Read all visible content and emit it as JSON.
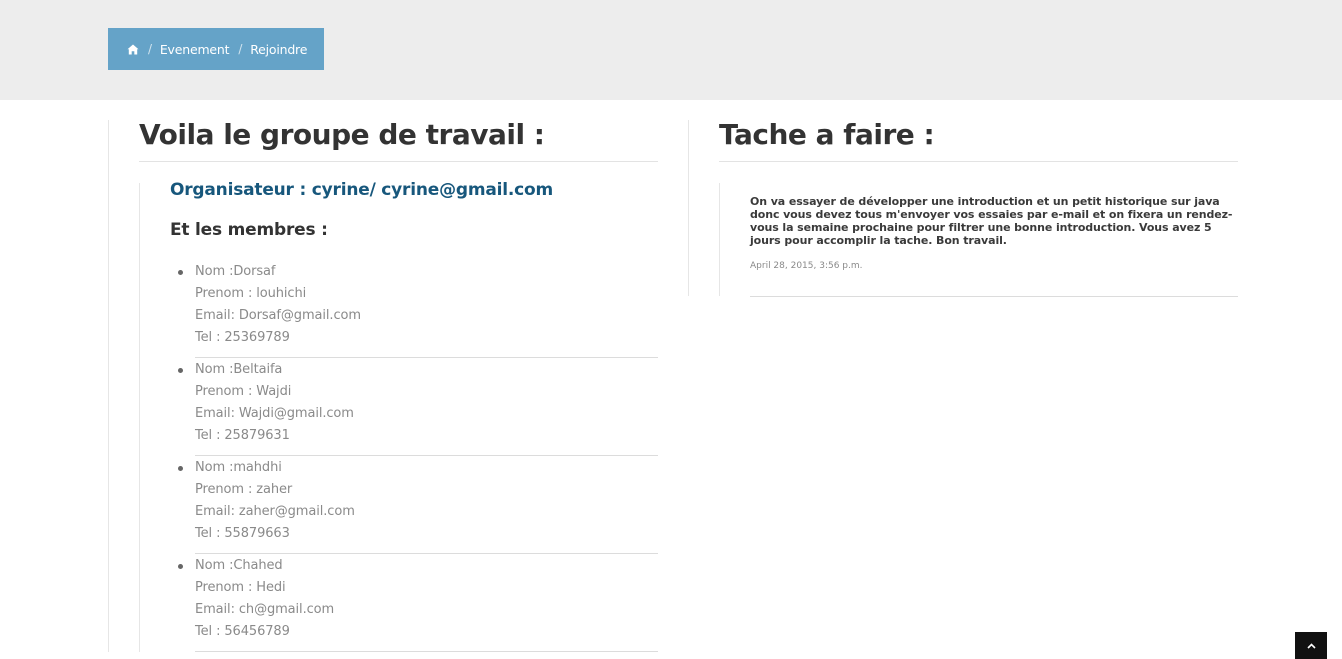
{
  "breadcrumb": {
    "home_icon": "home-icon",
    "separator": "/",
    "items": [
      "Evenement",
      "Rejoindre"
    ]
  },
  "left": {
    "title": "Voila le groupe de travail :",
    "organiser": "Organisateur : cyrine/ cyrine@gmail.com",
    "members_heading": "Et les membres :",
    "members": [
      {
        "nom": "Nom :Dorsaf",
        "prenom": "Prenom : louhichi",
        "email": "Email: Dorsaf@gmail.com",
        "tel": "Tel : 25369789"
      },
      {
        "nom": "Nom :Beltaifa",
        "prenom": "Prenom : Wajdi",
        "email": "Email: Wajdi@gmail.com",
        "tel": "Tel : 25879631"
      },
      {
        "nom": "Nom :mahdhi",
        "prenom": "Prenom : zaher",
        "email": "Email: zaher@gmail.com",
        "tel": "Tel : 55879663"
      },
      {
        "nom": "Nom :Chahed",
        "prenom": "Prenom : Hedi",
        "email": "Email: ch@gmail.com",
        "tel": "Tel : 56456789"
      }
    ]
  },
  "right": {
    "title": "Tache a faire :",
    "task_text": "On va essayer de développer une introduction et un petit historique sur java donc vous devez tous m'envoyer vos essaies par e-mail et on fixera un rendez-vous la semaine prochaine pour filtrer une bonne introduction. Vous avez 5 jours pour accomplir la tache. Bon travail.",
    "task_date": "April 28, 2015, 3:56 p.m."
  },
  "scroll_top_icon": "chevron-up-icon",
  "colors": {
    "topbar_bg": "#ededed",
    "breadcrumb_bg": "#65a3c8",
    "organiser_text": "#17577c",
    "heading_text": "#333333",
    "scroll_button_bg": "#111111"
  }
}
